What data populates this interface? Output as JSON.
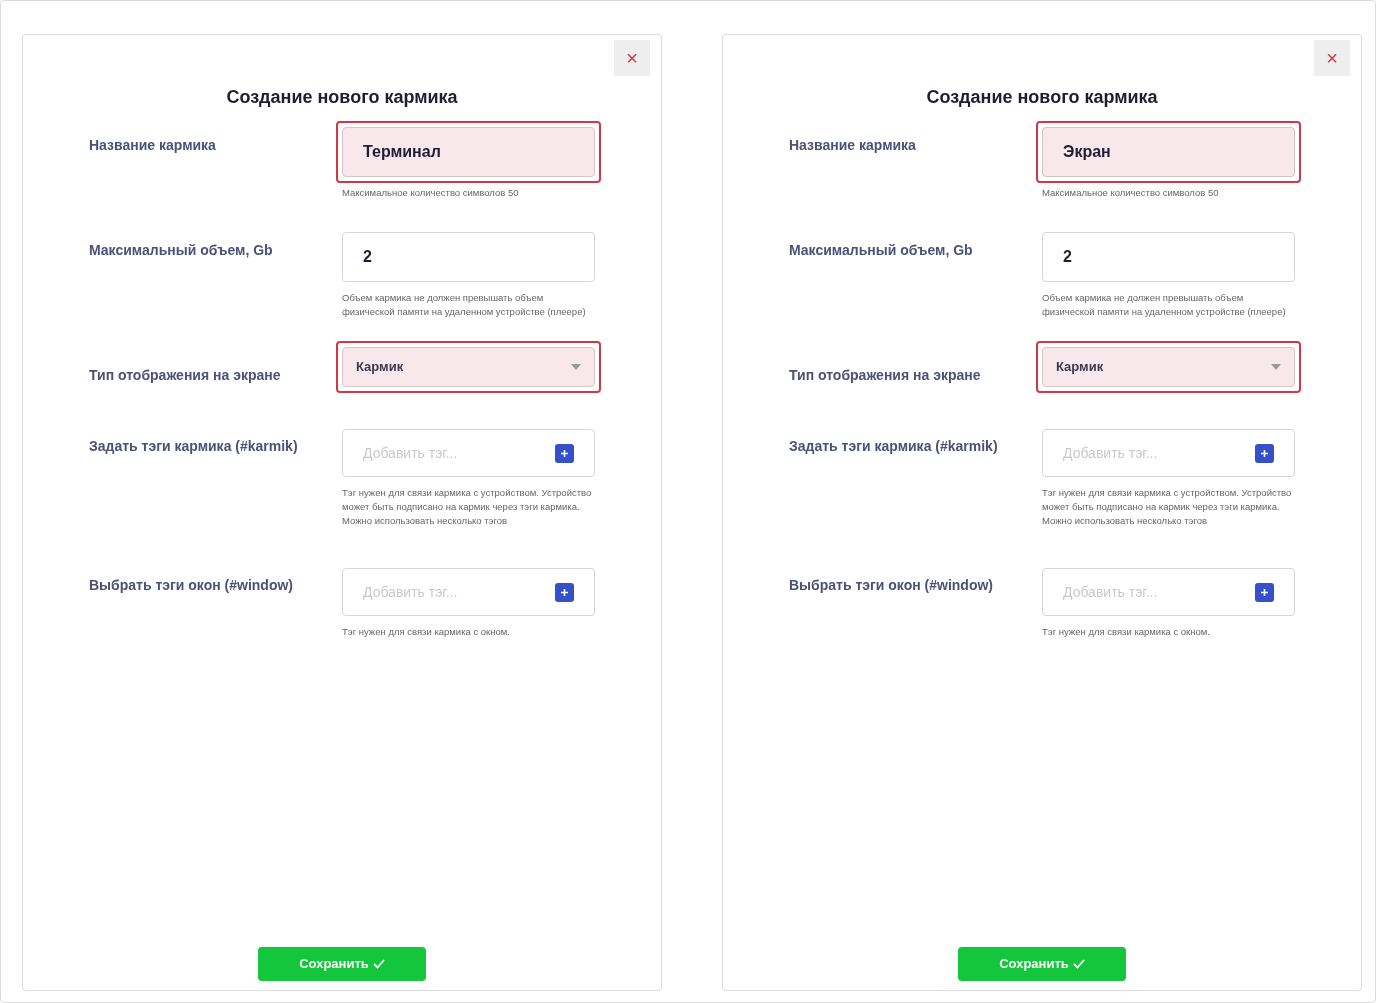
{
  "panels": [
    {
      "title": "Создание нового кармика",
      "close": "×",
      "save": "Сохранить",
      "fields": [
        {
          "kind": "text",
          "label": "Название кармика",
          "value": "Терминал",
          "highlighted": true,
          "hint": "Максимальное количество символов 50"
        },
        {
          "kind": "text",
          "label": "Максимальный объем, Gb",
          "value": "2",
          "highlighted": false,
          "hint": "Объем кармика не должен превышать объем физической памяти на удаленном устройстве (плеере)"
        },
        {
          "kind": "select",
          "label": "Тип отображения на экране",
          "value": "Кармик",
          "highlighted": true
        },
        {
          "kind": "tags",
          "label": "Задать тэги кармика (#karmik)",
          "placeholder": "Добавить тэг...",
          "highlighted": false,
          "hint": "Тэг нужен для связи кармика с устройством. Устройство может быть подписано на кармик через тэги кармика. Можно использовать несколько тэгов"
        },
        {
          "kind": "tags",
          "label": "Выбрать тэги окон (#window)",
          "placeholder": "Добавить тэг...",
          "highlighted": false,
          "hint": "Тэг нужен для связи кармика с окном."
        }
      ]
    },
    {
      "title": "Создание нового кармика",
      "close": "×",
      "save": "Сохранить",
      "fields": [
        {
          "kind": "text",
          "label": "Название кармика",
          "value": "Экран",
          "highlighted": true,
          "hint": "Максимальное количество символов 50"
        },
        {
          "kind": "text",
          "label": "Максимальный объем, Gb",
          "value": "2",
          "highlighted": false,
          "hint": "Объем кармика не должен превышать объем физической памяти на удаленном устройстве (плеере)"
        },
        {
          "kind": "select",
          "label": "Тип отображения на экране",
          "value": "Кармик",
          "highlighted": true
        },
        {
          "kind": "tags",
          "label": "Задать тэги кармика (#karmik)",
          "placeholder": "Добавить тэг...",
          "highlighted": false,
          "hint": "Тэг нужен для связи кармика с устройством. Устройство может быть подписано на кармик через тэги кармика. Можно использовать несколько тэгов"
        },
        {
          "kind": "tags",
          "label": "Выбрать тэги окон (#window)",
          "placeholder": "Добавить тэг...",
          "highlighted": false,
          "hint": "Тэг нужен для связи кармика с окном."
        }
      ]
    }
  ]
}
